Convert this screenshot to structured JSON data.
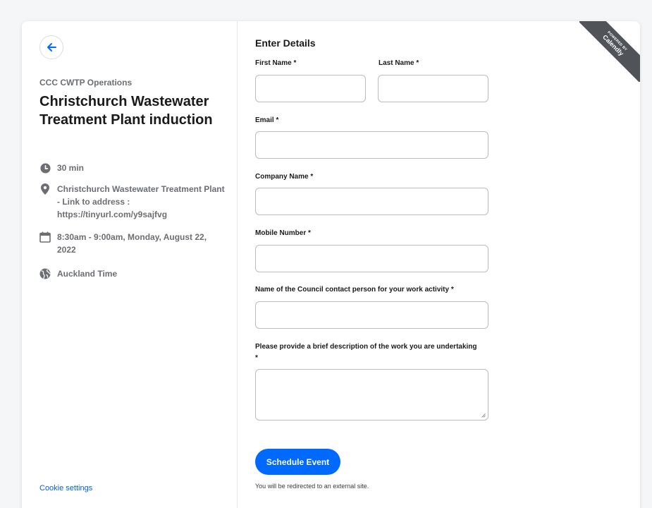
{
  "left": {
    "organizer": "CCC CWTP Operations",
    "title": "Christchurch Wastewater Treatment Plant induction",
    "duration": "30 min",
    "location": "Christchurch Wastewater Treatment Plant - Link to address : https://tinyurl.com/y9sajfvg",
    "datetime": "8:30am - 9:00am, Monday, August 22, 2022",
    "timezone": "Auckland Time",
    "cookie_link": "Cookie settings"
  },
  "form": {
    "heading": "Enter Details",
    "first_name_label": "First Name *",
    "last_name_label": "Last Name *",
    "email_label": "Email *",
    "company_label": "Company Name *",
    "mobile_label": "Mobile Number *",
    "contact_label": "Name of the Council contact person for your work activity *",
    "description_label": "Please provide a brief description of the work you are undertaking *",
    "values": {
      "first_name": "",
      "last_name": "",
      "email": "",
      "company": "",
      "mobile": "",
      "contact": "",
      "description": ""
    },
    "submit_label": "Schedule Event",
    "redirect_note": "You will be redirected to an external site."
  },
  "badge": {
    "powered_by": "POWERED BY",
    "brand": "Calendly"
  },
  "icons": {
    "back": "arrow-left-icon",
    "duration": "clock-icon",
    "location": "map-pin-icon",
    "datetime": "calendar-icon",
    "timezone": "globe-icon"
  },
  "colors": {
    "accent": "#0069ff",
    "text": "#1a1a1a",
    "muted": "#6b6e73",
    "ribbon": "#505459"
  }
}
